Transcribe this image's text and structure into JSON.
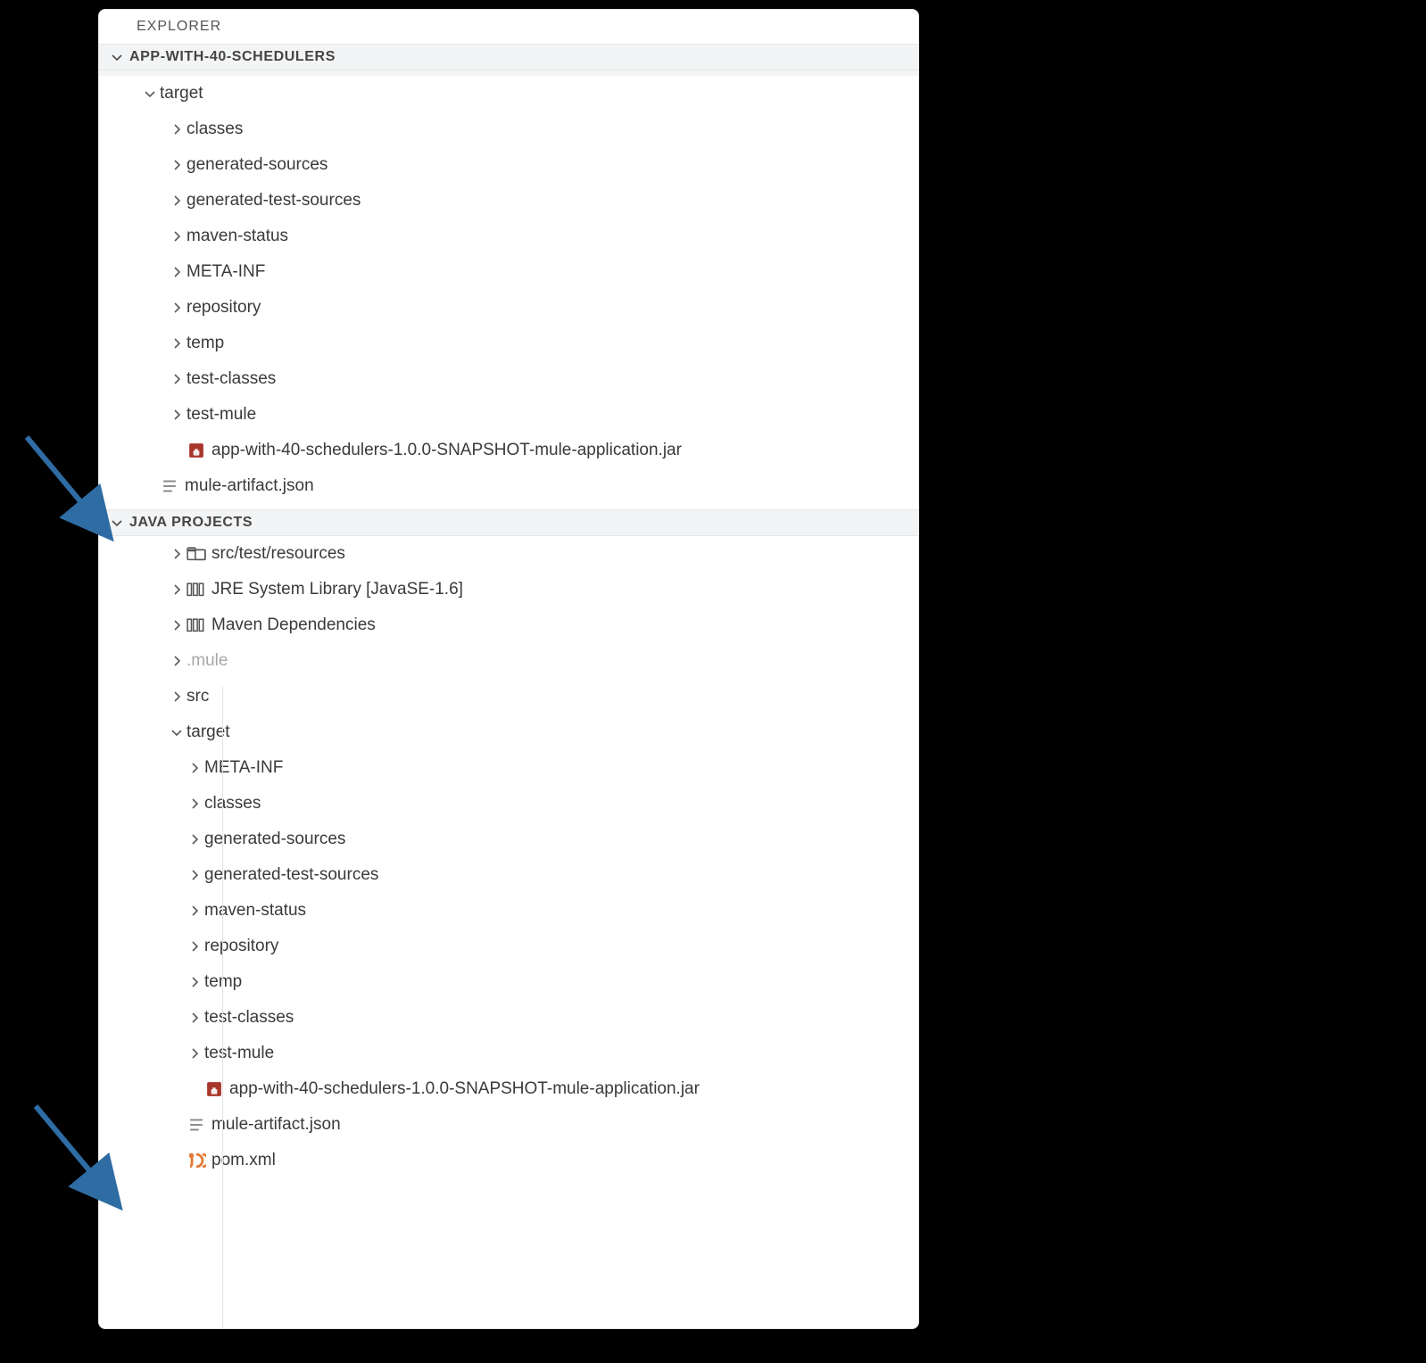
{
  "explorer_label": "EXPLORER",
  "project_section": "APP-WITH-40-SCHEDULERS",
  "java_projects_section": "JAVA PROJECTS",
  "arrow_color": "#2e6ca3",
  "explorer_tree": [
    {
      "label": "target",
      "depth": 1,
      "twisty": "down",
      "icon": null
    },
    {
      "label": "classes",
      "depth": 2,
      "twisty": "right",
      "icon": null
    },
    {
      "label": "generated-sources",
      "depth": 2,
      "twisty": "right",
      "icon": null
    },
    {
      "label": "generated-test-sources",
      "depth": 2,
      "twisty": "right",
      "icon": null
    },
    {
      "label": "maven-status",
      "depth": 2,
      "twisty": "right",
      "icon": null
    },
    {
      "label": "META-INF",
      "depth": 2,
      "twisty": "right",
      "icon": null
    },
    {
      "label": "repository",
      "depth": 2,
      "twisty": "right",
      "icon": null
    },
    {
      "label": "temp",
      "depth": 2,
      "twisty": "right",
      "icon": null
    },
    {
      "label": "test-classes",
      "depth": 2,
      "twisty": "right",
      "icon": null
    },
    {
      "label": "test-mule",
      "depth": 2,
      "twisty": "right",
      "icon": null
    },
    {
      "label": "app-with-40-schedulers-1.0.0-SNAPSHOT-mule-application.jar",
      "depth": 2,
      "twisty": null,
      "icon": "jar"
    },
    {
      "label": "mule-artifact.json",
      "depth": 1,
      "twisty": null,
      "icon": "json"
    }
  ],
  "java_tree": [
    {
      "label": "src/test/resources",
      "depth": 2,
      "twisty": "right",
      "icon": "folder"
    },
    {
      "label": "JRE System Library [JavaSE-1.6]",
      "depth": 2,
      "twisty": "right",
      "icon": "lib"
    },
    {
      "label": "Maven Dependencies",
      "depth": 2,
      "twisty": "right",
      "icon": "lib"
    },
    {
      "label": ".mule",
      "depth": 2,
      "twisty": "right",
      "icon": null,
      "muted": true
    },
    {
      "label": "src",
      "depth": 2,
      "twisty": "right",
      "icon": null
    },
    {
      "label": "target",
      "depth": 2,
      "twisty": "down",
      "icon": null
    },
    {
      "label": "META-INF",
      "depth": 3,
      "twisty": "right",
      "icon": null
    },
    {
      "label": "classes",
      "depth": 3,
      "twisty": "right",
      "icon": null
    },
    {
      "label": "generated-sources",
      "depth": 3,
      "twisty": "right",
      "icon": null
    },
    {
      "label": "generated-test-sources",
      "depth": 3,
      "twisty": "right",
      "icon": null
    },
    {
      "label": "maven-status",
      "depth": 3,
      "twisty": "right",
      "icon": null
    },
    {
      "label": "repository",
      "depth": 3,
      "twisty": "right",
      "icon": null
    },
    {
      "label": "temp",
      "depth": 3,
      "twisty": "right",
      "icon": null
    },
    {
      "label": "test-classes",
      "depth": 3,
      "twisty": "right",
      "icon": null
    },
    {
      "label": "test-mule",
      "depth": 3,
      "twisty": "right",
      "icon": null
    },
    {
      "label": "app-with-40-schedulers-1.0.0-SNAPSHOT-mule-application.jar",
      "depth": 3,
      "twisty": null,
      "icon": "jar"
    },
    {
      "label": "mule-artifact.json",
      "depth": 2,
      "twisty": null,
      "icon": "json"
    },
    {
      "label": "pom.xml",
      "depth": 2,
      "twisty": null,
      "icon": "xml"
    }
  ]
}
